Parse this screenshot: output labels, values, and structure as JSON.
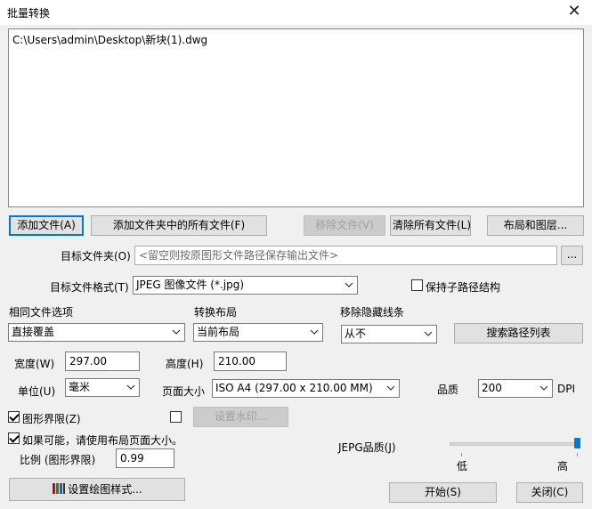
{
  "window": {
    "title": "批量转换",
    "close_glyph": "✕"
  },
  "files": [
    "C:\\Users\\admin\\Desktop\\新块(1).dwg"
  ],
  "buttons": {
    "add_file": "添加文件(A)",
    "add_folder": "添加文件夹中的所有文件(F)",
    "remove_file": "移除文件(V)",
    "clear_all": "清除所有文件(L)",
    "layouts_layers": "布局和图层...",
    "browse": "...",
    "search_paths": "搜索路径列表",
    "watermark": "设置水印...",
    "plot_style": "设置绘图样式...",
    "start": "开始(S)",
    "close": "关闭(C)"
  },
  "target_folder": {
    "label": "目标文件夹(O)",
    "placeholder": "<留空则按原图形文件路径保存输出文件>"
  },
  "target_format": {
    "label": "目标文件格式(T)",
    "value": "JPEG 图像文件 (*.jpg)"
  },
  "keep_subpath": {
    "label": "保持子路径结构",
    "checked": false
  },
  "same_file": {
    "label": "相同文件选项",
    "value": "直接覆盖"
  },
  "convert_layout": {
    "label": "转换布局",
    "value": "当前布局"
  },
  "remove_hidden": {
    "label": "移除隐藏线条",
    "value": "从不"
  },
  "width": {
    "label": "宽度(W)",
    "value": "297.00"
  },
  "height": {
    "label": "高度(H)",
    "value": "210.00"
  },
  "unit": {
    "label": "单位(U)",
    "value": "毫米"
  },
  "page_size": {
    "label": "页面大小",
    "value": "ISO A4 (297.00 x 210.00 MM)"
  },
  "quality": {
    "label": "品质",
    "value": "200",
    "unit": "DPI"
  },
  "drawing_limits": {
    "label": "图形界限(Z)",
    "checked": true
  },
  "watermark_check": {
    "checked": false
  },
  "use_layout_size": {
    "label": "如果可能，请使用布局页面大小。",
    "checked": true
  },
  "scale": {
    "label": "比例 (图形界限)",
    "value": "0.99"
  },
  "jpeg_quality": {
    "label": "JEPG品质(J)",
    "low": "低",
    "high": "高",
    "level": 1.0
  },
  "colors": {
    "focus": "#0078d7",
    "slider_thumb": "#0078d7"
  }
}
